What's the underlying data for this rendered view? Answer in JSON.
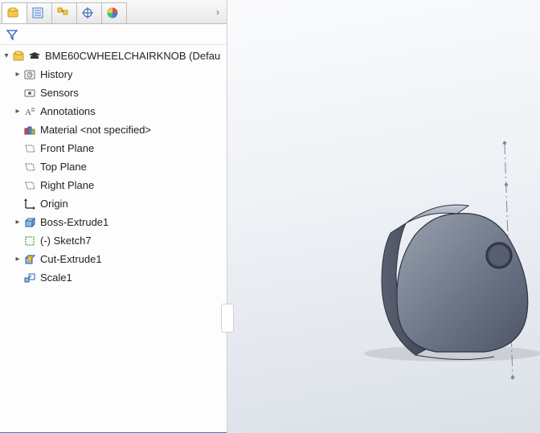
{
  "tabs": {
    "chevron": "›"
  },
  "tree": {
    "root": {
      "label": "BME60CWHEELCHAIRKNOB (Defau"
    },
    "items": [
      {
        "label": "History",
        "icon": "history-icon",
        "expander": "closed"
      },
      {
        "label": "Sensors",
        "icon": "sensors-icon",
        "expander": "empty"
      },
      {
        "label": "Annotations",
        "icon": "annotations-icon",
        "expander": "closed"
      },
      {
        "label": "Material <not specified>",
        "icon": "material-icon",
        "expander": "empty"
      },
      {
        "label": "Front Plane",
        "icon": "plane-icon",
        "expander": "empty"
      },
      {
        "label": "Top Plane",
        "icon": "plane-icon",
        "expander": "empty"
      },
      {
        "label": "Right Plane",
        "icon": "plane-icon",
        "expander": "empty"
      },
      {
        "label": "Origin",
        "icon": "origin-icon",
        "expander": "empty"
      },
      {
        "label": "Boss-Extrude1",
        "icon": "extrude-icon",
        "expander": "closed"
      },
      {
        "label": "(-) Sketch7",
        "icon": "sketch-icon",
        "expander": "empty"
      },
      {
        "label": "Cut-Extrude1",
        "icon": "cut-icon",
        "expander": "closed"
      },
      {
        "label": "Scale1",
        "icon": "scale-icon",
        "expander": "empty"
      }
    ]
  }
}
